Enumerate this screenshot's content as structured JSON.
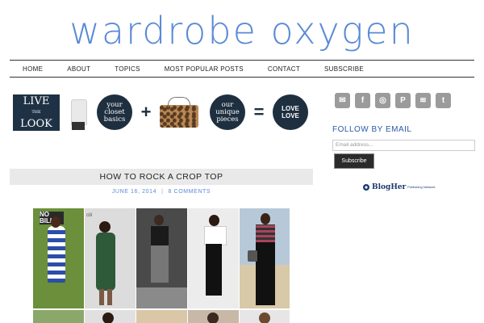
{
  "site": {
    "title": "wardrobe oxygen"
  },
  "nav": {
    "items": [
      "HOME",
      "ABOUT",
      "TOPICS",
      "MOST POPULAR POSTS",
      "CONTACT",
      "SUBSCRIBE"
    ]
  },
  "banner": {
    "live_top": "LIVE",
    "live_mid": "THE",
    "live_bottom": "LOOK",
    "basics": "your closet basics",
    "plus": "+",
    "unique": "our unique pieces",
    "equals": "=",
    "love": "LOVE LOVE"
  },
  "post": {
    "title": "HOW TO ROCK A CROP TOP",
    "date": "JUNE 16, 2014",
    "comments": "8 COMMENTS"
  },
  "sidebar": {
    "social_icons": [
      "email-icon",
      "facebook-icon",
      "instagram-icon",
      "pinterest-icon",
      "rss-icon",
      "twitter-icon"
    ],
    "social_glyphs": [
      "✉",
      "f",
      "◎",
      "P",
      "≋",
      "t"
    ],
    "follow_heading": "FOLLOW BY EMAIL",
    "email_placeholder": "Email address...",
    "subscribe_label": "Subscribe",
    "blogher_logo": "BlogHer",
    "blogher_sub": "Publishing Network"
  },
  "colors": {
    "brand_blue": "#5b8ad6",
    "navy": "#1e2f3f",
    "link_blue": "#2a5aa8"
  }
}
